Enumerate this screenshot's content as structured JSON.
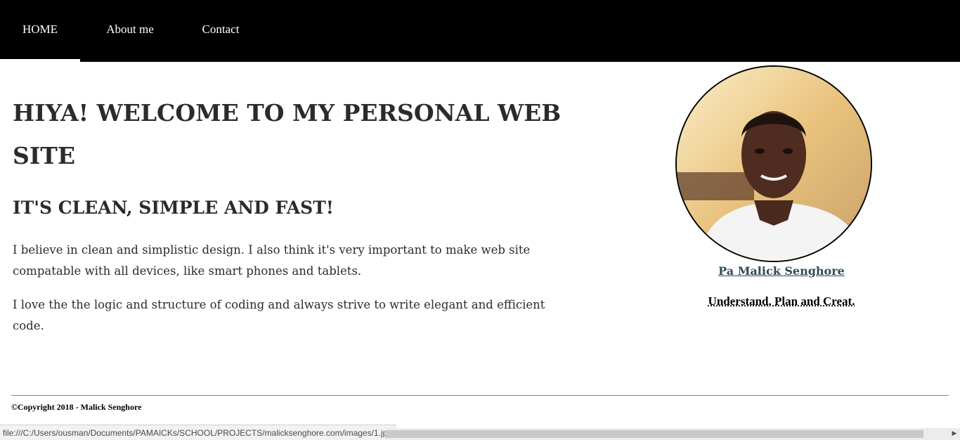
{
  "nav": {
    "items": [
      {
        "label": "HOME",
        "active": true
      },
      {
        "label": "About me",
        "active": false
      },
      {
        "label": "Contact",
        "active": false
      }
    ]
  },
  "main": {
    "heading": "HIYA! WELCOME TO MY PERSONAL WEB SITE",
    "subheading": "IT'S CLEAN, SIMPLE AND FAST!",
    "paragraphs": [
      "I believe in clean and simplistic design. I also think it's very important to make web site compatable with all devices, like smart phones and tablets.",
      "I love the the logic and structure of coding and always strive to write elegant and efficient code."
    ]
  },
  "profile": {
    "name": "Pa Malick Senghore",
    "tagline": "Understand, Plan and Creat."
  },
  "footer": {
    "copyright": "©Copyright 2018 - Malick Senghore"
  },
  "status_bar": {
    "url": "file:///C:/Users/ousman/Documents/PAMAICKs/SCHOOL/PROJECTS/malicksenghore.com/images/1.jpg"
  },
  "colors": {
    "nav_background": "#000000",
    "text": "#2b2b2b",
    "link": "#2f4a55"
  }
}
